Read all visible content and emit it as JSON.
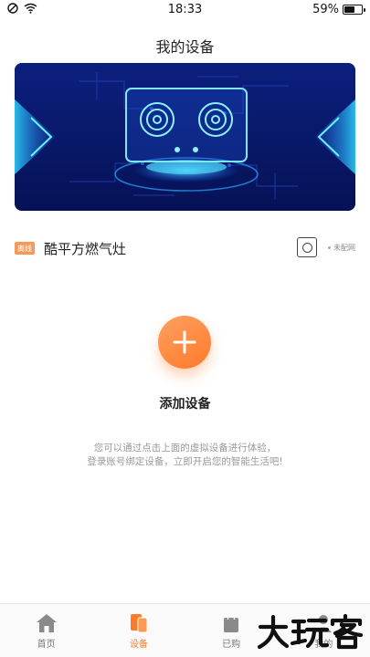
{
  "status_bar": {
    "time": "18:33",
    "battery_percent_label": "59%",
    "battery_level": 0.59
  },
  "header": {
    "title": "我的设备"
  },
  "device": {
    "badge": "离线",
    "name": "酷平方燃气灶",
    "status": "未配网"
  },
  "add_device": {
    "label": "添加设备",
    "hint_line1": "您可以通过点击上面的虚拟设备进行体验，",
    "hint_line2": "登录账号绑定设备，立即开启您的智能生活吧!"
  },
  "tabs": [
    {
      "label": "首页",
      "icon": "home-icon",
      "active": false
    },
    {
      "label": "设备",
      "icon": "devices-icon",
      "active": true
    },
    {
      "label": "已购",
      "icon": "shopping-bag-icon",
      "active": false
    },
    {
      "label": "我的",
      "icon": "profile-icon",
      "active": false
    }
  ],
  "watermark": {
    "text": "大玩客"
  },
  "colors": {
    "accent": "#ff7a2a",
    "badge": "#f39a5b",
    "banner_bg": "#0a1b6e",
    "banner_glow": "#27c8ff"
  }
}
